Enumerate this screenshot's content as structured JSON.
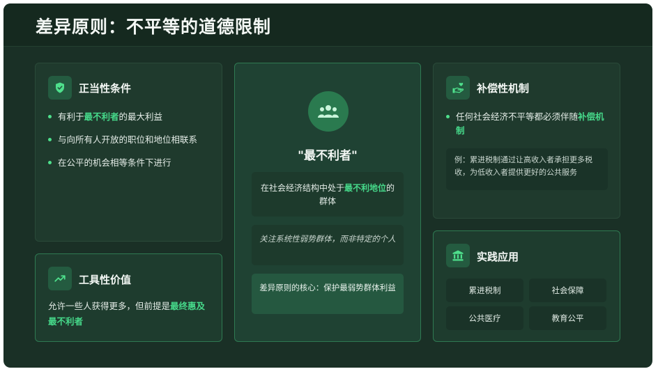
{
  "title": "差异原则：不平等的道德限制",
  "left_top": {
    "title": "正当性条件",
    "icon": "shield-check-icon",
    "items": [
      {
        "pre": "有利于",
        "hl": "最不利者",
        "post": "的最大利益"
      },
      {
        "pre": "与向所有人开放的职位和地位相联系",
        "hl": "",
        "post": ""
      },
      {
        "pre": "在公平的机会相等条件下进行",
        "hl": "",
        "post": ""
      }
    ]
  },
  "left_bottom": {
    "title": "工具性价值",
    "icon": "trending-up-icon",
    "text_pre": "允许一些人获得更多，但前提是",
    "text_hl": "最终惠及最不利者"
  },
  "center": {
    "icon": "users-group-icon",
    "title": "\"最不利者\"",
    "box1_pre": "在社会经济结构中处于",
    "box1_hl": "最不利地位",
    "box1_post": "的群体",
    "box2": "关注系统性弱势群体，而非特定的个人",
    "box3": "差异原则的核心：保护最弱势群体利益"
  },
  "right_top": {
    "title": "补偿性机制",
    "icon": "hand-heart-icon",
    "item_pre": "任何社会经济不平等都必须伴随",
    "item_hl": "补偿机制",
    "example": "例：累进税制通过让高收入者承担更多税收，为低收入者提供更好的公共服务"
  },
  "right_bottom": {
    "title": "实践应用",
    "icon": "bank-icon",
    "tags": [
      "累进税制",
      "社会保障",
      "公共医疗",
      "教育公平"
    ]
  },
  "colors": {
    "accent": "#46d98a",
    "background": "#1a3026",
    "card": "#1f3a2d"
  }
}
